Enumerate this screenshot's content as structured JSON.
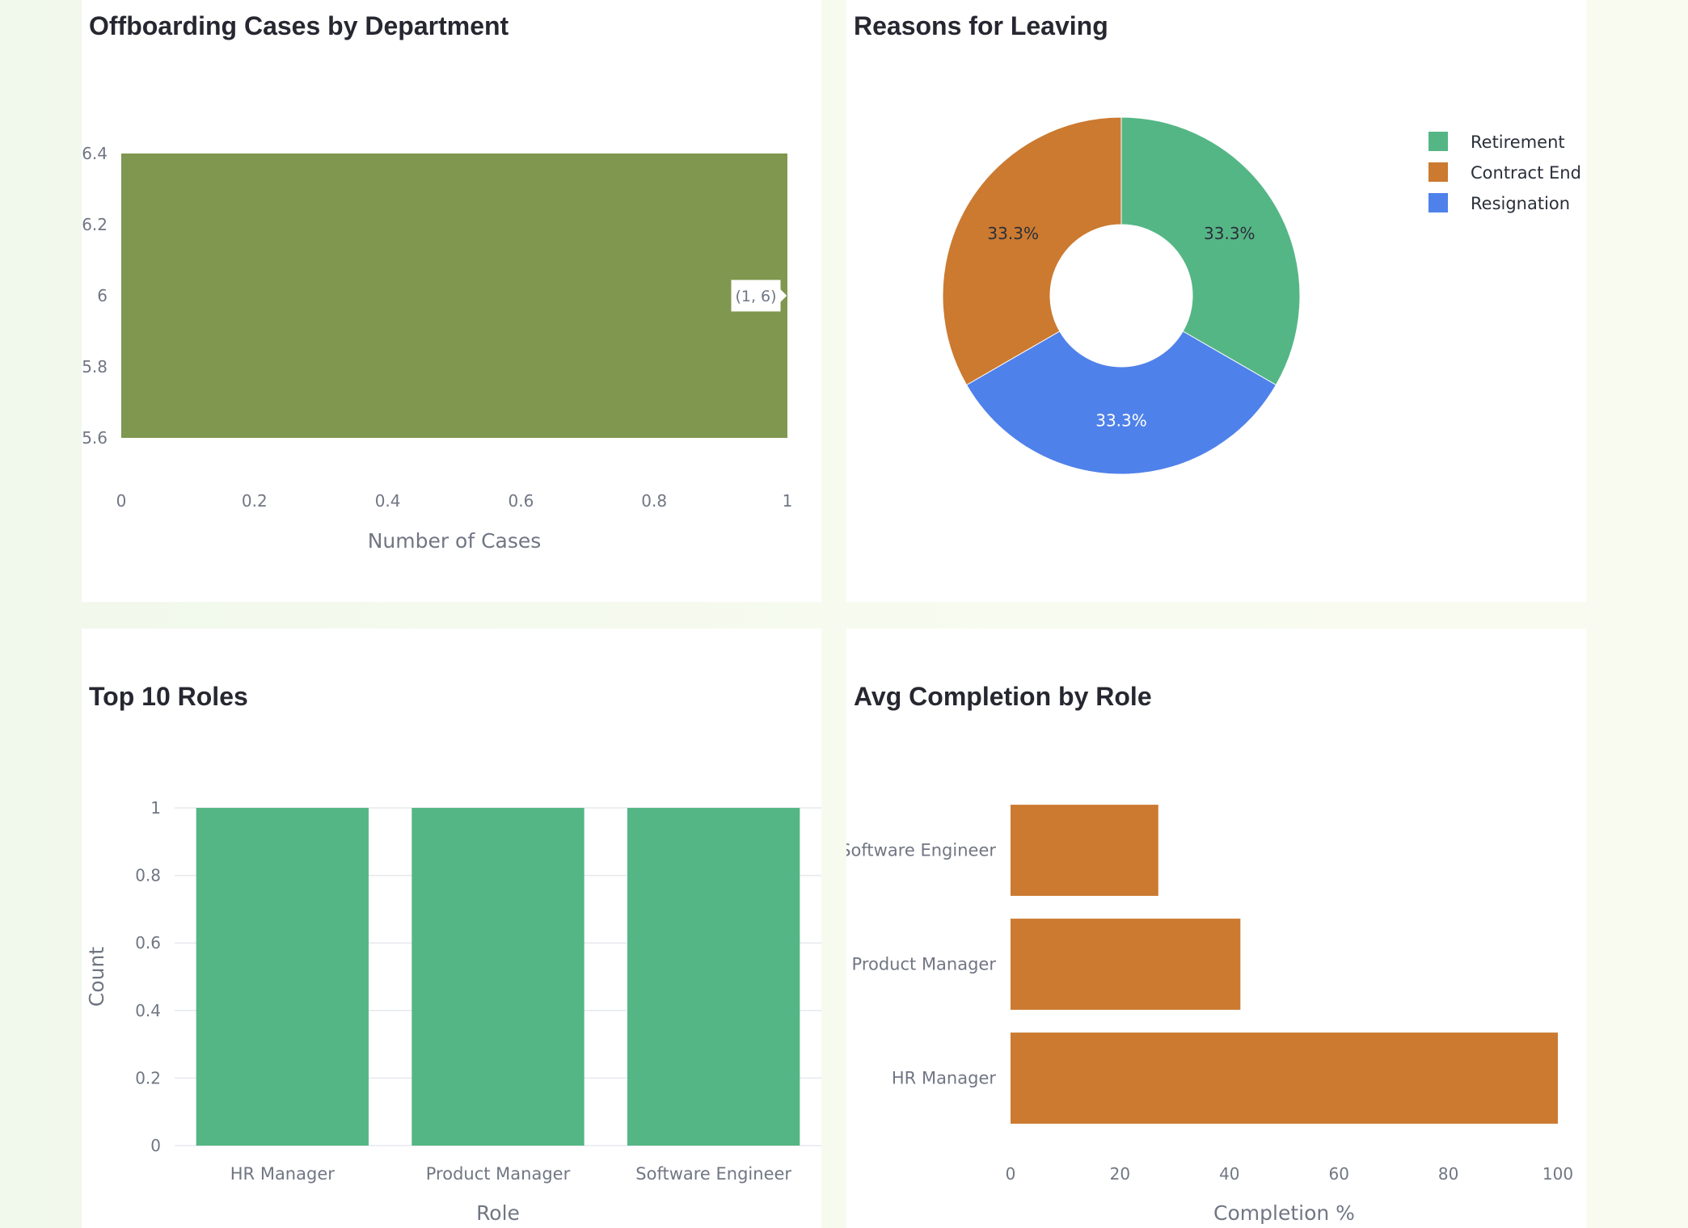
{
  "colors": {
    "olive": "#7f974f",
    "green": "#55b685",
    "orange": "#cb7a30",
    "blue": "#4f81ea",
    "axis_text": "#707683",
    "grid": "#e6e9ed",
    "title": "#262730"
  },
  "panels": {
    "dept": {
      "title": "Offboarding Cases by Department"
    },
    "reasons": {
      "title": "Reasons for Leaving"
    },
    "roles": {
      "title": "Top 10 Roles"
    },
    "completion": {
      "title": "Avg Completion by Role"
    }
  },
  "chart_data": [
    {
      "type": "bar",
      "orientation": "h",
      "title": "Offboarding Cases by Department",
      "xlabel": "Number of Cases",
      "ylabel": "",
      "xlim": [
        0,
        1
      ],
      "ylim": [
        5.6,
        6.4
      ],
      "x_ticks": [
        0,
        0.2,
        0.4,
        0.6,
        0.8,
        1
      ],
      "y_ticks": [
        5.6,
        5.8,
        6,
        6.2,
        6.4
      ],
      "y_tick_labels": [
        "5.6",
        "5.8",
        "6",
        "6.2",
        "6.4"
      ],
      "points": [
        {
          "x": 1,
          "y": 6
        }
      ],
      "hover_label": "(1, 6)",
      "color": "#7f974f",
      "grid": false
    },
    {
      "type": "pie",
      "hole": true,
      "title": "Reasons for Leaving",
      "labels": [
        "Retirement",
        "Contract End",
        "Resignation"
      ],
      "values": [
        1,
        1,
        1
      ],
      "percent_labels": [
        "33.3%",
        "33.3%",
        "33.3%"
      ],
      "colors": [
        "#55b685",
        "#cb7a30",
        "#4f81ea"
      ],
      "legend_position": "top-right"
    },
    {
      "type": "bar",
      "title": "Top 10 Roles",
      "xlabel": "Role",
      "ylabel": "Count",
      "categories": [
        "HR Manager",
        "Product Manager",
        "Software Engineer"
      ],
      "values": [
        1,
        1,
        1
      ],
      "ylim": [
        0,
        1
      ],
      "y_ticks": [
        0,
        0.2,
        0.4,
        0.6,
        0.8,
        1
      ],
      "color": "#55b685",
      "grid": true
    },
    {
      "type": "bar",
      "orientation": "h",
      "title": "Avg Completion by Role",
      "xlabel": "Completion %",
      "ylabel": "",
      "categories": [
        "HR Manager",
        "Product Manager",
        "Software Engineer"
      ],
      "values": [
        100,
        42,
        27
      ],
      "xlim": [
        0,
        100
      ],
      "x_ticks": [
        0,
        20,
        40,
        60,
        80,
        100
      ],
      "color": "#cb7a30",
      "grid": false
    }
  ]
}
